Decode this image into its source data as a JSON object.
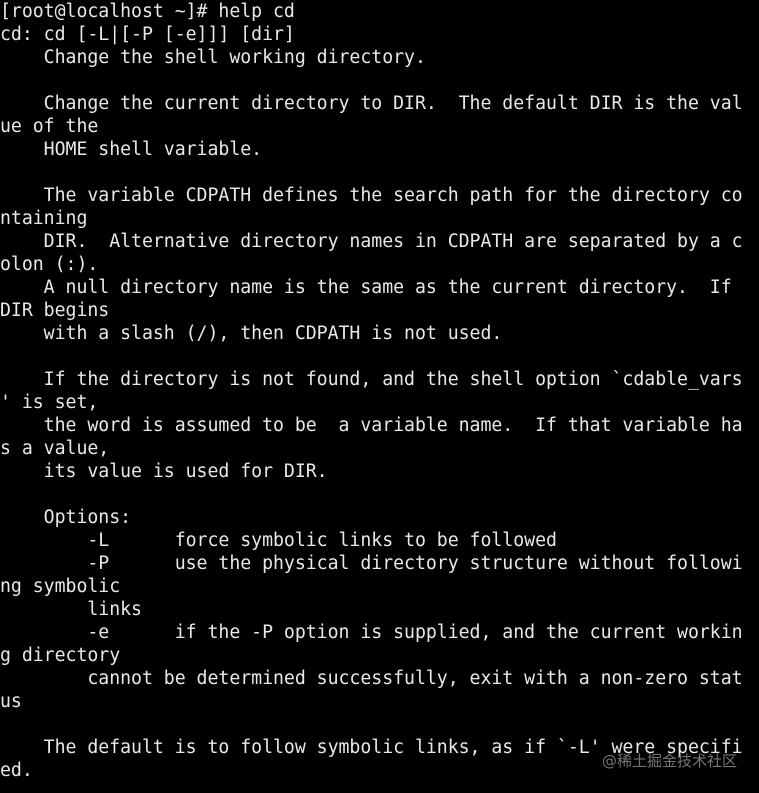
{
  "terminal": {
    "prompt": "[root@localhost ~]# help cd",
    "lines": [
      "[root@localhost ~]# help cd",
      "cd: cd [-L|[-P [-e]]] [dir]",
      "    Change the shell working directory.",
      "",
      "    Change the current directory to DIR.  The default DIR is the val",
      "ue of the",
      "    HOME shell variable.",
      "",
      "    The variable CDPATH defines the search path for the directory co",
      "ntaining",
      "    DIR.  Alternative directory names in CDPATH are separated by a c",
      "olon (:).",
      "    A null directory name is the same as the current directory.  If",
      "DIR begins",
      "    with a slash (/), then CDPATH is not used.",
      "",
      "    If the directory is not found, and the shell option `cdable_vars",
      "' is set,",
      "    the word is assumed to be  a variable name.  If that variable ha",
      "s a value,",
      "    its value is used for DIR.",
      "",
      "    Options:",
      "        -L      force symbolic links to be followed",
      "        -P      use the physical directory structure without followi",
      "ng symbolic",
      "        links",
      "        -e      if the -P option is supplied, and the current workin",
      "g directory",
      "        cannot be determined successfully, exit with a non-zero stat",
      "us",
      "",
      "    The default is to follow symbolic links, as if `-L' were specifi",
      "ed."
    ]
  },
  "watermark": "@稀土掘金技术社区",
  "colors": {
    "background": "#000000",
    "foreground": "#e8e8e8",
    "watermark": "#8a8a8a"
  }
}
